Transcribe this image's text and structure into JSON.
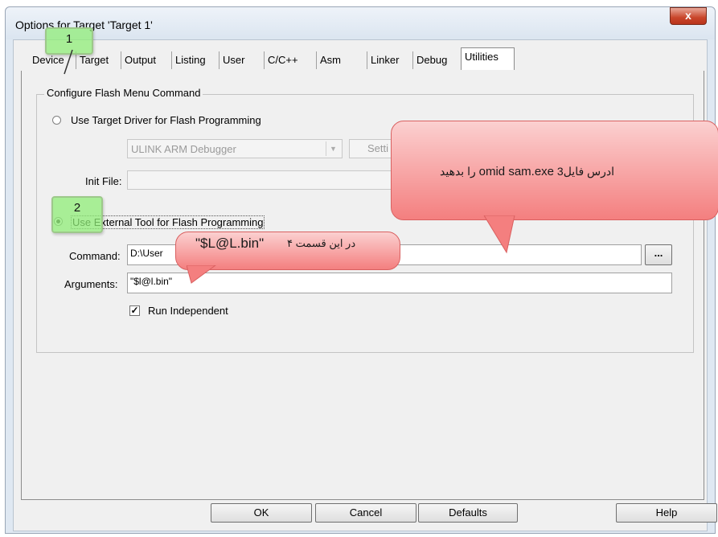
{
  "window": {
    "title": "Options for Target 'Target 1'",
    "close_label": "x"
  },
  "tabs": [
    {
      "label": "Device",
      "active": false
    },
    {
      "label": "Target",
      "active": false
    },
    {
      "label": "Output",
      "active": false
    },
    {
      "label": "Listing",
      "active": false
    },
    {
      "label": "User",
      "active": false
    },
    {
      "label": "C/C++",
      "active": false
    },
    {
      "label": "Asm",
      "active": false
    },
    {
      "label": "Linker",
      "active": false
    },
    {
      "label": "Debug",
      "active": false
    },
    {
      "label": "Utilities",
      "active": true
    }
  ],
  "group": {
    "title": "Configure Flash Menu Command",
    "use_target_driver_label": "Use Target Driver for Flash Programming",
    "driver_select_value": "ULINK ARM Debugger",
    "settings_label": "Setti",
    "init_file_label": "Init File:",
    "init_file_value": "",
    "use_external_label": "Use External Tool for Flash Programming",
    "command_label": "Command:",
    "command_value": "D:\\User",
    "browse_label": "...",
    "arguments_label": "Arguments:",
    "arguments_value": "\"$l@l.bin\"",
    "run_independent_label": "Run Independent",
    "run_independent_checked": true
  },
  "buttons": {
    "ok": "OK",
    "cancel": "Cancel",
    "defaults": "Defaults",
    "help": "Help"
  },
  "annotations": {
    "note1": "1",
    "note2": "2",
    "bubble3_num": "3",
    "bubble3_text_rtl": "ادرس فایل",
    "bubble3_file": "omid sam.exe",
    "bubble3_tail": "را بدهید",
    "bubble4_text": "۴ در این قسمت",
    "bubble4_value": "\"$L@L.bin\""
  },
  "colors": {
    "note_green": "#90ee78",
    "bubble_red": "#f47f7f",
    "window_frame": "#dfe8f2",
    "close_red": "#c9452a"
  }
}
